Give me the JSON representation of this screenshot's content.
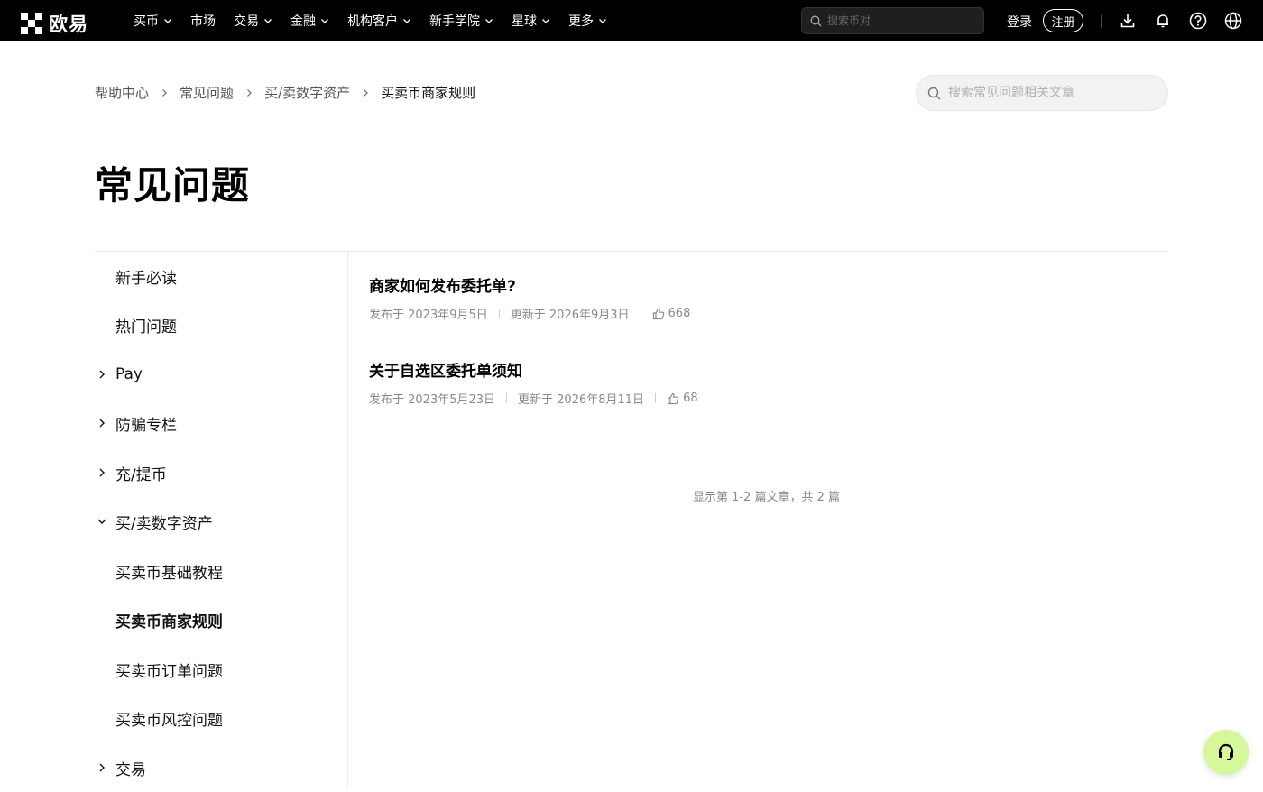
{
  "brand": {
    "name": "欧易"
  },
  "topnav": {
    "items": [
      {
        "label": "买币",
        "has_dropdown": true
      },
      {
        "label": "市场",
        "has_dropdown": false
      },
      {
        "label": "交易",
        "has_dropdown": true
      },
      {
        "label": "金融",
        "has_dropdown": true
      },
      {
        "label": "机构客户",
        "has_dropdown": true
      },
      {
        "label": "新手学院",
        "has_dropdown": true
      },
      {
        "label": "星球",
        "has_dropdown": true
      },
      {
        "label": "更多",
        "has_dropdown": true
      }
    ],
    "search_placeholder": "搜索币对",
    "login_label": "登录",
    "register_label": "注册",
    "icons": [
      "download-icon",
      "bell-icon",
      "help-icon",
      "globe-icon"
    ]
  },
  "breadcrumb": {
    "items": [
      "帮助中心",
      "常见问题",
      "买/卖数字资产",
      "买卖币商家规则"
    ]
  },
  "faq_search": {
    "placeholder": "搜索常见问题相关文章"
  },
  "page_title": "常见问题",
  "sidebar": {
    "items": [
      {
        "label": "新手必读",
        "arrow": "none"
      },
      {
        "label": "热门问题",
        "arrow": "none"
      },
      {
        "label": "Pay",
        "arrow": "right"
      },
      {
        "label": "防骗专栏",
        "arrow": "right"
      },
      {
        "label": "充/提币",
        "arrow": "right"
      },
      {
        "label": "买/卖数字资产",
        "arrow": "down"
      },
      {
        "label": "买卖币基础教程",
        "arrow": "none"
      },
      {
        "label": "买卖币商家规则",
        "arrow": "none",
        "active": true
      },
      {
        "label": "买卖币订单问题",
        "arrow": "none"
      },
      {
        "label": "买卖币风控问题",
        "arrow": "none"
      },
      {
        "label": "交易",
        "arrow": "right"
      }
    ]
  },
  "articles": [
    {
      "title": "商家如何发布委托单?",
      "published": "发布于 2023年9月5日",
      "updated": "更新于 2026年9月3日",
      "likes": "668"
    },
    {
      "title": "关于自选区委托单须知",
      "published": "发布于 2023年5月23日",
      "updated": "更新于 2026年8月11日",
      "likes": "68"
    }
  ],
  "pager_info": "显示第 1-2 篇文章，共 2 篇",
  "colors": {
    "nav_bg": "#000000",
    "support_bg": "#d6f79a"
  }
}
